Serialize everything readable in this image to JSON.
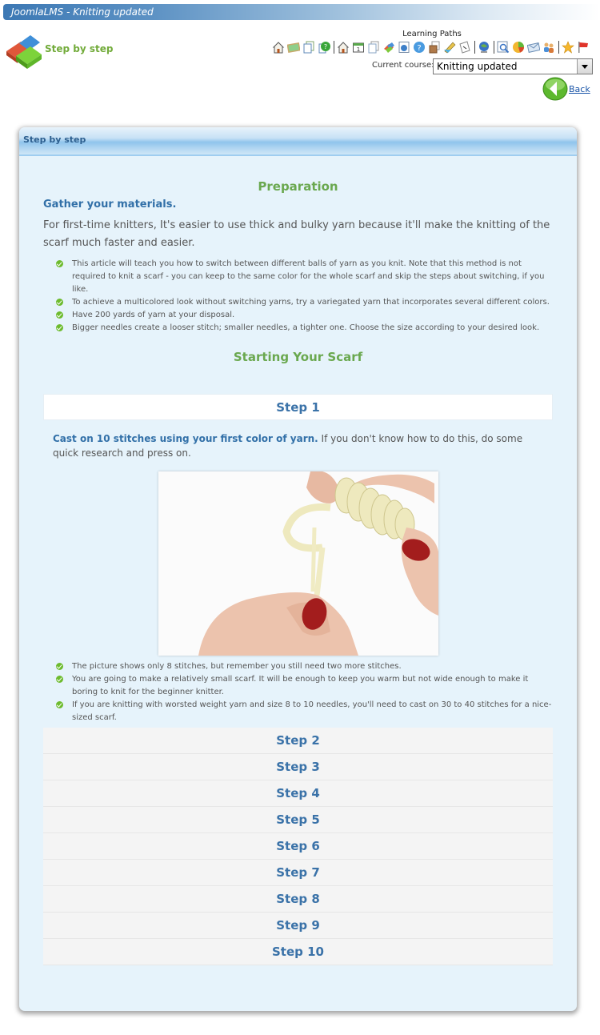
{
  "window": {
    "title": "JoomlaLMS - Knitting updated"
  },
  "header": {
    "app_title": "Step by step",
    "toolbar_group_label": "Learning Paths",
    "toolbar_icons": [
      "home-icon",
      "chalkboard-icon",
      "documents-icon",
      "help-docs-icon",
      "home-icon",
      "calendar-icon",
      "documents-icon",
      "tools-icon",
      "web-icon",
      "help-icon",
      "package-icon",
      "edit-icon",
      "note-icon",
      "globe-icon",
      "search-icon",
      "chart-icon",
      "mail-icon",
      "users-icon",
      "star-icon",
      "flag-icon"
    ],
    "course_label": "Current course:",
    "course_selected": "Knitting updated",
    "back_label": "Back"
  },
  "panel": {
    "title": "Step by step",
    "preparation": {
      "title": "Preparation",
      "lead": "Gather your materials.",
      "paragraph": "For first-time knitters, It's easier to use thick and bulky yarn because it'll make the knitting of the scarf much faster and easier.",
      "bullets": [
        "This article will teach you how to switch between different balls of yarn as you knit. Note that this method is not required to knit a scarf - you can keep to the same color for the whole scarf and skip the steps about switching, if you like.",
        "To achieve a multicolored look without switching yarns, try a variegated yarn that incorporates several different colors.",
        "Have 200 yards of yarn at your disposal.",
        "Bigger needles create a looser stitch; smaller needles, a tighter one. Choose the size according to your desired look."
      ]
    },
    "starting": {
      "title": "Starting Your Scarf"
    },
    "steps": [
      {
        "label": "Step 1",
        "expanded": true,
        "lead": "Cast on 10 stitches using your first color of yarn.",
        "text": " If you don't know how to do this, do some quick research and press on.",
        "image_alt": "Hands casting on yarn stitches",
        "bullets": [
          "The picture shows only 8 stitches, but remember you still need two more stitches.",
          "You are going to make a relatively small scarf. It will be enough to keep you warm but not wide enough to make it boring to knit for the beginner knitter.",
          "If you are knitting with worsted weight yarn and size 8 to 10 needles, you'll need to cast on 30 to 40 stitches for a nice-sized scarf."
        ]
      },
      {
        "label": "Step 2",
        "expanded": false
      },
      {
        "label": "Step 3",
        "expanded": false
      },
      {
        "label": "Step 4",
        "expanded": false
      },
      {
        "label": "Step 5",
        "expanded": false
      },
      {
        "label": "Step 6",
        "expanded": false
      },
      {
        "label": "Step 7",
        "expanded": false
      },
      {
        "label": "Step 8",
        "expanded": false
      },
      {
        "label": "Step 9",
        "expanded": false
      },
      {
        "label": "Step 10",
        "expanded": false
      }
    ]
  },
  "colors": {
    "accent_green": "#6aa84f",
    "link_blue": "#3270a8",
    "panel_bg": "#e6f3fb"
  }
}
